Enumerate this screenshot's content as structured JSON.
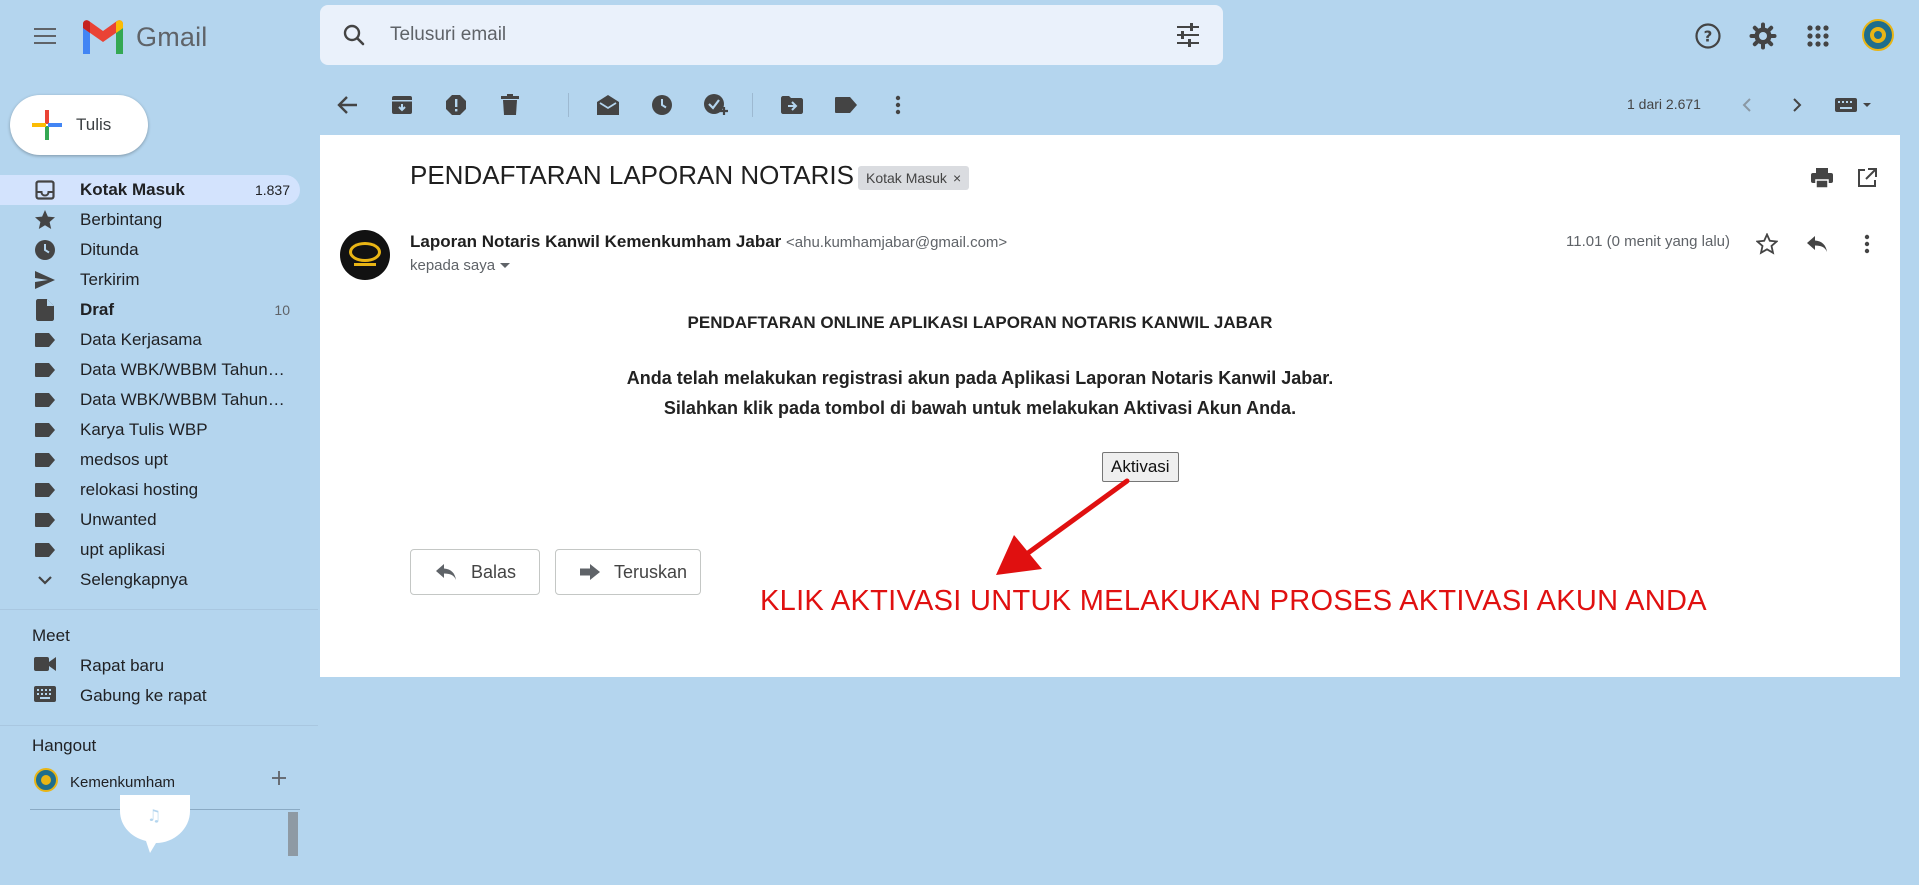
{
  "app": {
    "name": "Gmail"
  },
  "search": {
    "placeholder": "Telusuri email"
  },
  "compose": {
    "label": "Tulis"
  },
  "sidebar": {
    "items": [
      {
        "label": "Kotak Masuk",
        "count": "1.837",
        "icon": "inbox-icon"
      },
      {
        "label": "Berbintang",
        "icon": "star-icon"
      },
      {
        "label": "Ditunda",
        "icon": "clock-icon"
      },
      {
        "label": "Terkirim",
        "icon": "send-icon"
      },
      {
        "label": "Draf",
        "count": "10",
        "icon": "draft-icon"
      },
      {
        "label": "Data Kerjasama",
        "icon": "label-icon"
      },
      {
        "label": "Data WBK/WBBM Tahun…",
        "icon": "label-icon"
      },
      {
        "label": "Data WBK/WBBM Tahun…",
        "icon": "label-icon"
      },
      {
        "label": "Karya Tulis WBP",
        "icon": "label-icon"
      },
      {
        "label": "medsos upt",
        "icon": "label-icon"
      },
      {
        "label": "relokasi hosting",
        "icon": "label-icon"
      },
      {
        "label": "Unwanted",
        "icon": "label-icon"
      },
      {
        "label": "upt aplikasi",
        "icon": "label-icon"
      },
      {
        "label": "Selengkapnya",
        "icon": "chevron-down-icon"
      }
    ]
  },
  "meet": {
    "title": "Meet",
    "new_meeting": "Rapat baru",
    "join_meeting": "Gabung ke rapat"
  },
  "hangout": {
    "title": "Hangout",
    "user": "Kemenkumham"
  },
  "toolbar": {
    "pager": "1 dari 2.671"
  },
  "message": {
    "subject": "PENDAFTARAN LAPORAN NOTARIS",
    "label": "Kotak Masuk",
    "sender_name": "Laporan Notaris Kanwil Kemenkumham Jabar",
    "sender_email": "<ahu.kumhamjabar@gmail.com>",
    "to": "kepada saya",
    "time": "11.01 (0 menit yang lalu)",
    "body_title": "PENDAFTARAN ONLINE APLIKASI LAPORAN NOTARIS KANWIL JABAR",
    "body_line1": "Anda telah melakukan registrasi akun pada Aplikasi Laporan Notaris Kanwil Jabar.",
    "body_line2": "Silahkan klik pada tombol di bawah untuk melakukan Aktivasi Akun Anda.",
    "button": "Aktivasi",
    "reply": "Balas",
    "forward": "Teruskan"
  },
  "annotation": {
    "text": "KLIK AKTIVASI UNTUK MELAKUKAN PROSES AKTIVASI AKUN ANDA",
    "color": "#e01010"
  },
  "colors": {
    "background": "#b4d5ee",
    "active_nav": "#d3e3fd"
  }
}
